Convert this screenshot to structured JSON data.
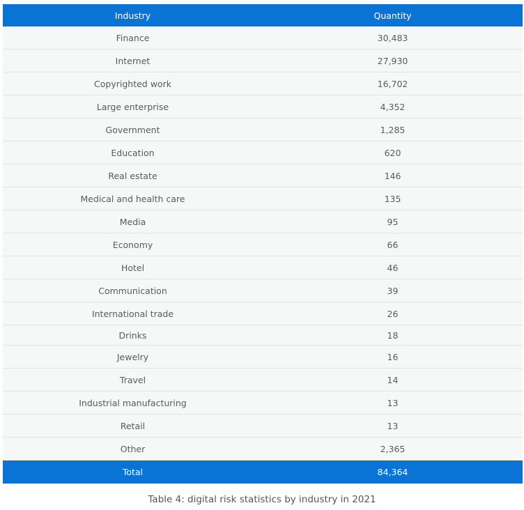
{
  "table": {
    "headers": [
      "Industry",
      "Quantity"
    ],
    "rows": [
      {
        "industry": "Finance",
        "quantity": "30,483"
      },
      {
        "industry": "Internet",
        "quantity": "27,930"
      },
      {
        "industry": "Copyrighted work",
        "quantity": "16,702"
      },
      {
        "industry": "Large enterprise",
        "quantity": "4,352"
      },
      {
        "industry": "Government",
        "quantity": "1,285"
      },
      {
        "industry": "Education",
        "quantity": "620"
      },
      {
        "industry": "Real estate",
        "quantity": "146"
      },
      {
        "industry": "Medical and health care",
        "quantity": "135"
      },
      {
        "industry": "Media",
        "quantity": "95"
      },
      {
        "industry": "Economy",
        "quantity": "66"
      },
      {
        "industry": "Hotel",
        "quantity": "46"
      },
      {
        "industry": "Communication",
        "quantity": "39"
      },
      {
        "industry": "International trade",
        "quantity": "26"
      },
      {
        "industry": "Drinks",
        "quantity": "18"
      },
      {
        "industry": "Jewelry",
        "quantity": "16"
      },
      {
        "industry": "Travel",
        "quantity": "14"
      },
      {
        "industry": "Industrial manufacturing",
        "quantity": "13"
      },
      {
        "industry": "Retail",
        "quantity": "13"
      },
      {
        "industry": "Other",
        "quantity": "2,365"
      }
    ],
    "total": {
      "label": "Total",
      "quantity": "84,364"
    }
  },
  "caption": "Table 4: digital risk statistics by industry in 2021",
  "colors": {
    "header_bg": "#0a74d6",
    "row_bg": "#f6f7f7",
    "row_border": "#e2e3e3",
    "text": "#5a5a5a"
  }
}
